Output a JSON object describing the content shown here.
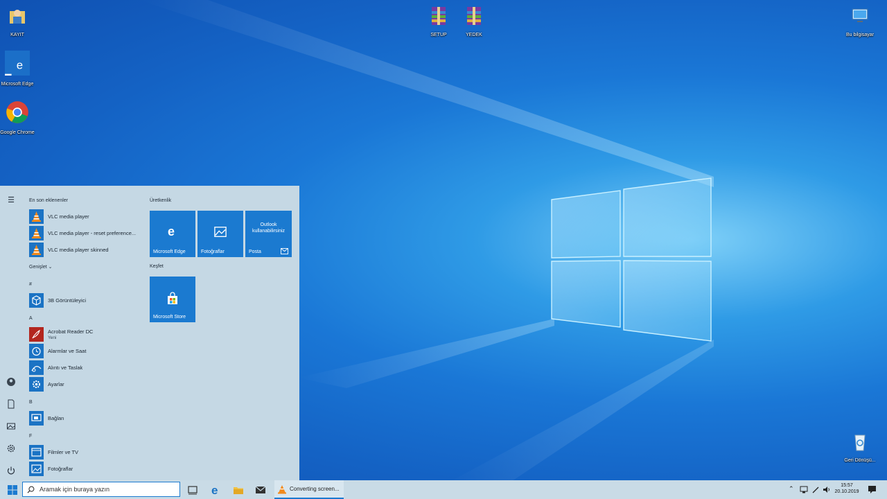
{
  "desktop": {
    "icons": [
      {
        "label": "KAYIT",
        "icon": "user-folder-icon"
      },
      {
        "label": "Microsoft Edge",
        "icon": "edge-shortcut-icon"
      },
      {
        "label": "Google Chrome",
        "icon": "chrome-shortcut-icon"
      },
      {
        "label": "SETUP",
        "icon": "winrar-archive-icon"
      },
      {
        "label": "YEDEK",
        "icon": "winrar-archive-icon"
      },
      {
        "label": "Bu bilgisayar",
        "icon": "this-pc-icon"
      },
      {
        "label": "Geri Dönüşü...",
        "icon": "recycle-bin-icon"
      }
    ]
  },
  "start_menu": {
    "recent_header": "En son eklenenler",
    "recent_apps": [
      {
        "label": "VLC media player",
        "icon": "vlc-icon"
      },
      {
        "label": "VLC media player - reset preference...",
        "icon": "vlc-icon"
      },
      {
        "label": "VLC media player skinned",
        "icon": "vlc-icon"
      }
    ],
    "expand_label": "Genişlet",
    "groups": [
      {
        "letter": "#",
        "apps": [
          {
            "label": "3B Görüntüleyici",
            "sub": "",
            "icon": "3d-viewer-icon"
          }
        ]
      },
      {
        "letter": "A",
        "apps": [
          {
            "label": "Acrobat Reader DC",
            "sub": "Yeni",
            "icon": "acrobat-icon"
          },
          {
            "label": "Alarmlar ve Saat",
            "sub": "",
            "icon": "alarm-clock-icon"
          },
          {
            "label": "Alıntı ve Taslak",
            "sub": "",
            "icon": "snip-sketch-icon"
          },
          {
            "label": "Ayarlar",
            "sub": "",
            "icon": "settings-gear-icon"
          }
        ]
      },
      {
        "letter": "B",
        "apps": [
          {
            "label": "Bağlan",
            "sub": "",
            "icon": "connect-icon"
          }
        ]
      },
      {
        "letter": "F",
        "apps": [
          {
            "label": "Filmler ve TV",
            "sub": "",
            "icon": "film-icon"
          },
          {
            "label": "Fotoğraflar",
            "sub": "",
            "icon": "photos-icon"
          }
        ]
      }
    ],
    "productivity_header": "Üretkenlik",
    "productivity_tiles": [
      {
        "label": "Microsoft Edge",
        "icon": "edge-icon"
      },
      {
        "label": "Fotoğraflar",
        "icon": "photos-icon"
      },
      {
        "label": "Posta",
        "caption": "Outlook kullanabilirsiniz",
        "icon": "mail-icon"
      }
    ],
    "explore_header": "Keşfet",
    "explore_tiles": [
      {
        "label": "Microsoft Store",
        "icon": "store-bag-icon"
      }
    ]
  },
  "taskbar": {
    "search_placeholder": "Aramak için buraya yazın",
    "running_app": "Converting screen...",
    "time": "15:57",
    "date": "20.10.2019"
  },
  "colors": {
    "accent": "#1b7ad0",
    "menu_bg": "#c5d8e4",
    "taskbar_bg": "#c9dbe6"
  }
}
